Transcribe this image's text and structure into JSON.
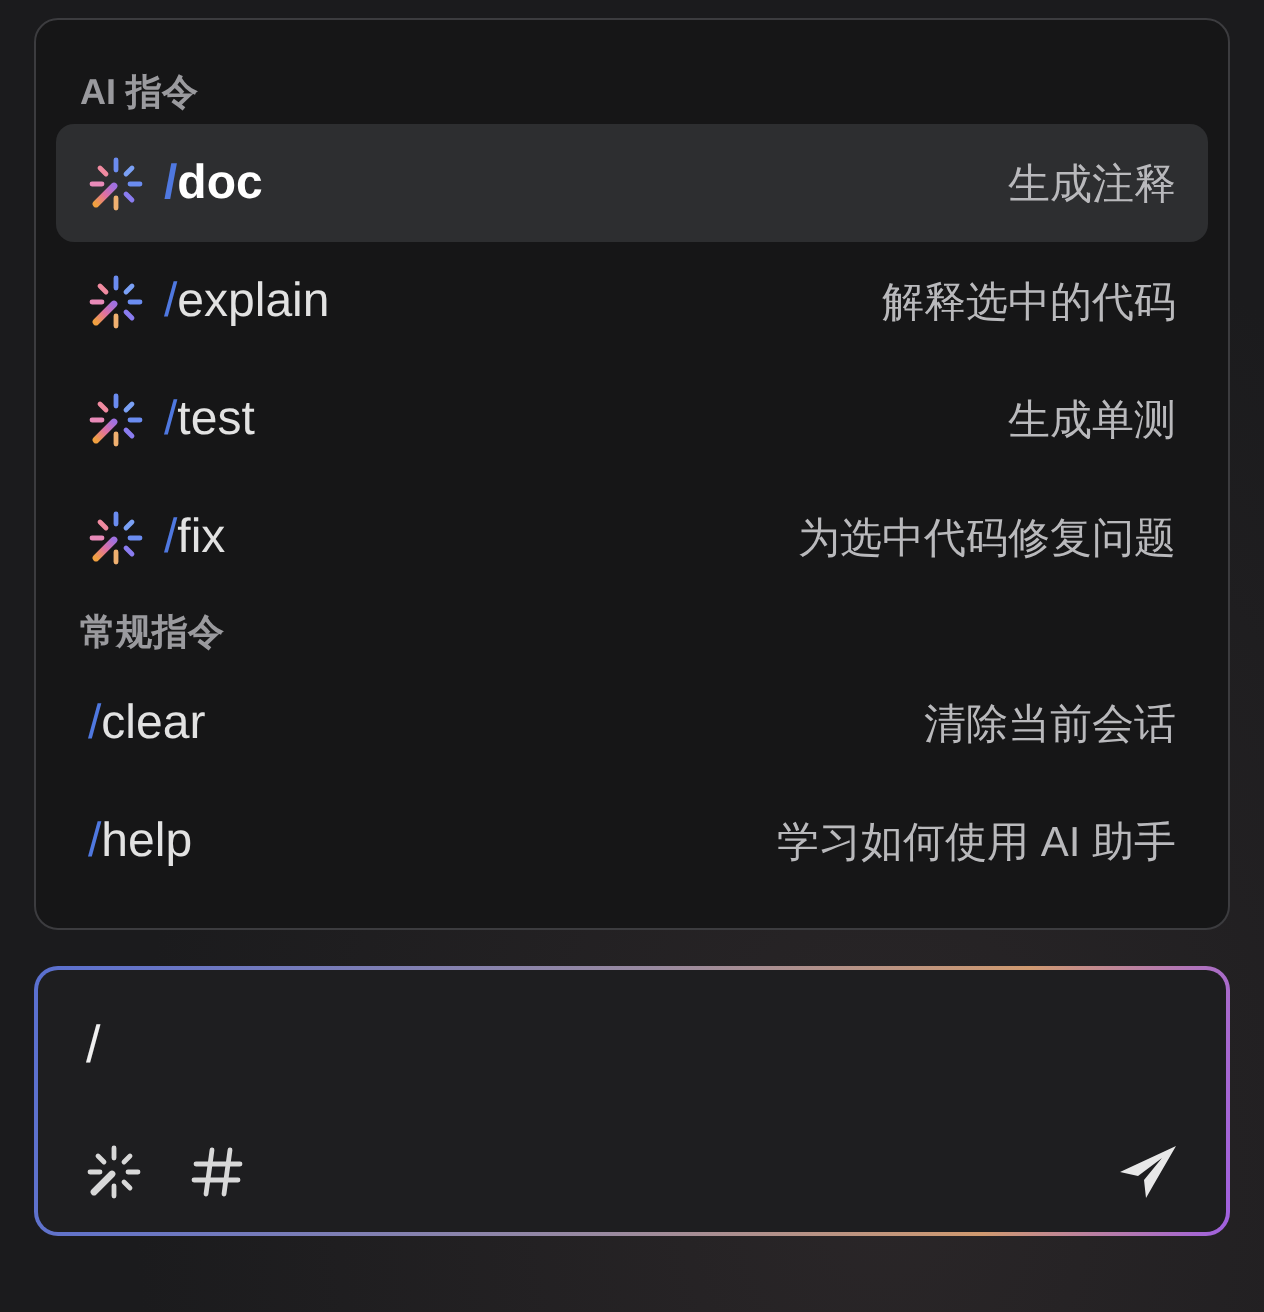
{
  "command_menu": {
    "groups": [
      {
        "title": "AI 指令",
        "items": [
          {
            "kind": "ai",
            "prefix": "/",
            "command": "doc",
            "description": "生成注释",
            "selected": true
          },
          {
            "kind": "ai",
            "prefix": "/",
            "command": "explain",
            "description": "解释选中的代码",
            "selected": false
          },
          {
            "kind": "ai",
            "prefix": "/",
            "command": "test",
            "description": "生成单测",
            "selected": false
          },
          {
            "kind": "ai",
            "prefix": "/",
            "command": "fix",
            "description": "为选中代码修复问题",
            "selected": false
          }
        ]
      },
      {
        "title": "常规指令",
        "items": [
          {
            "kind": "plain",
            "prefix": "/",
            "command": "clear",
            "description": "清除当前会话",
            "selected": false
          },
          {
            "kind": "plain",
            "prefix": "/",
            "command": "help",
            "description": "学习如何使用 AI 助手",
            "selected": false
          }
        ]
      }
    ]
  },
  "input": {
    "value": "/"
  }
}
